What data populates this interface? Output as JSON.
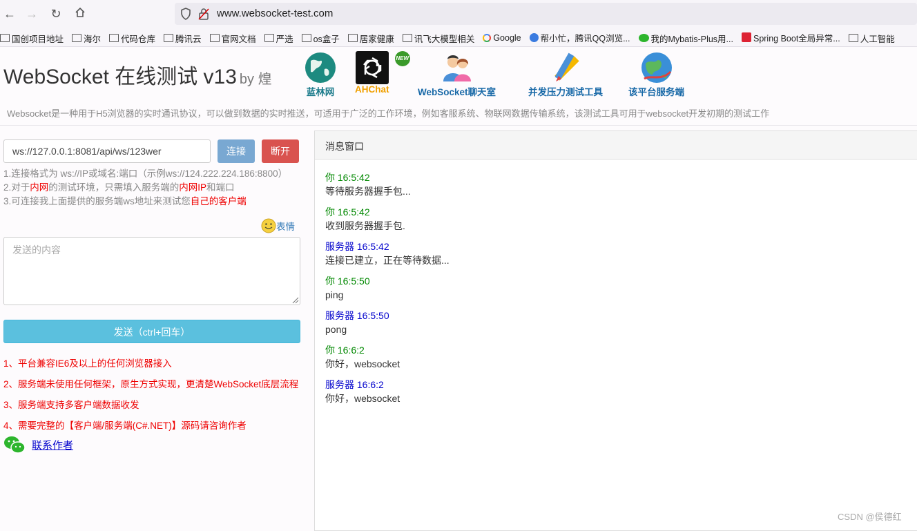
{
  "browser": {
    "url": "www.websocket-test.com",
    "bookmarks": [
      "国创项目地址",
      "海尔",
      "代码仓库",
      "腾讯云",
      "官网文档",
      "严选",
      "os盒子",
      "居家健康",
      "讯飞大模型相关",
      "Google",
      "帮小忙，腾讯QQ浏览...",
      "我的Mybatis-Plus用...",
      "Spring Boot全局异常...",
      "人工智能"
    ]
  },
  "header": {
    "title": "WebSocket 在线测试 v13",
    "by": "by 煌",
    "nav": [
      {
        "label": "蓝林网",
        "color": "#1a7a8a",
        "icon": "globe-icon"
      },
      {
        "label": "AHChat",
        "color": "#f0a000",
        "icon": "chatgpt-icon",
        "badge": "NEW"
      },
      {
        "label": "WebSocket聊天室",
        "color": "#1a6aa8",
        "icon": "people-icon"
      },
      {
        "label": "并发压力测试工具",
        "color": "#1a6aa8",
        "icon": "pencil-ruler-icon"
      },
      {
        "label": "该平台服务端",
        "color": "#1a6aa8",
        "icon": "earth-icon"
      }
    ],
    "subtitle": "Websocket是一种用于H5浏览器的实时通讯协议，可以做到数据的实时推送，可适用于广泛的工作环境，例如客服系统、物联网数据传输系统，该测试工具可用于websocket开发初期的测试工作"
  },
  "left": {
    "ws_url": "ws://127.0.0.1:8081/api/ws/123wer",
    "connect_label": "连接",
    "disconnect_label": "断开",
    "tip1": "1.连接格式为 ws://IP或域名:端口（示例ws://124.222.224.186:8800）",
    "tip2_a": "2.对于",
    "tip2_b": "内网",
    "tip2_c": "的测试环境，只需填入服务端的",
    "tip2_d": "内网IP",
    "tip2_e": "和端口",
    "tip3_a": "3.可连接我上面提供的服务端ws地址来测试您",
    "tip3_b": "自己的客户端",
    "emoji_label": "表情",
    "textarea_placeholder": "发送的内容",
    "send_label": "发送（ctrl+回车）",
    "notes": [
      "1、平台兼容IE6及以上的任何浏览器接入",
      "2、服务端未使用任何框架，原生方式实现，更清楚WebSocket底层流程",
      "3、服务端支持多客户端数据收发",
      "4、需要完整的【客户端/服务端(C#.NET)】源码请咨询作者"
    ],
    "contact_label": "联系作者"
  },
  "panel": {
    "title": "消息窗口",
    "messages": [
      {
        "who": "你 16:5:42",
        "text": "等待服务器握手包..."
      },
      {
        "who": "你 16:5:42",
        "text": "收到服务器握手包."
      },
      {
        "who": "服务器 16:5:42",
        "text": "连接已建立，正在等待数据..."
      },
      {
        "who": "你 16:5:50",
        "text": "ping"
      },
      {
        "who": "服务器 16:5:50",
        "text": "pong"
      },
      {
        "who": "你 16:6:2",
        "text": "你好，websocket"
      },
      {
        "who": "服务器 16:6:2",
        "text": "你好，websocket"
      }
    ]
  },
  "watermark": "CSDN @侯德红"
}
